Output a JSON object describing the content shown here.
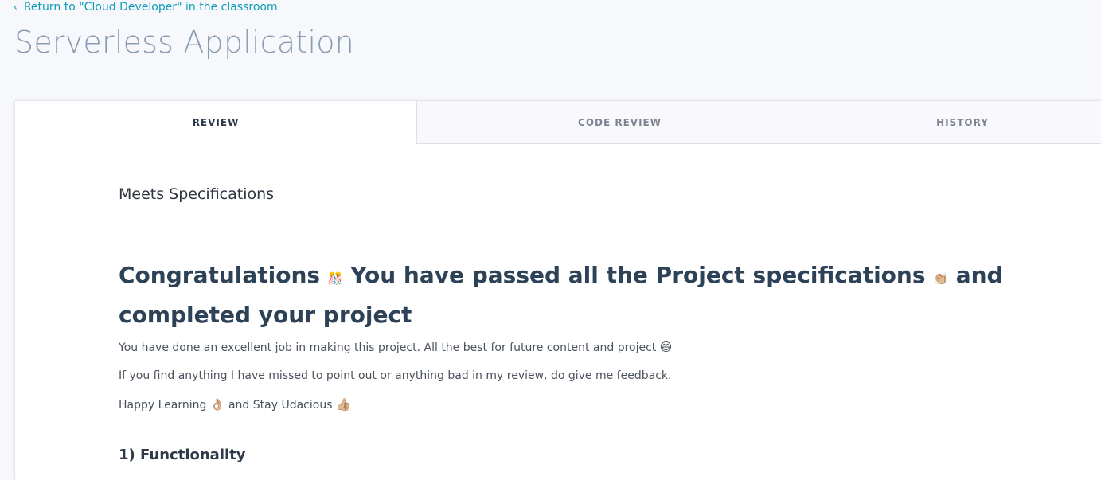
{
  "header": {
    "back_chevron": "‹",
    "back_link": "Return to \"Cloud Developer\" in the classroom",
    "title": "Serverless Application"
  },
  "tabs": [
    {
      "label": "REVIEW",
      "active": true
    },
    {
      "label": "CODE REVIEW",
      "active": false
    },
    {
      "label": "HISTORY",
      "active": false
    }
  ],
  "review": {
    "status": "Meets Specifications",
    "headline": {
      "part1": "Congratulations ",
      "emoji1": "🎊",
      "part2": " You have passed all the Project specifications ",
      "emoji2": "👏🏼",
      "part3": " and completed your project"
    },
    "paragraph1": {
      "text": "You have done an excellent job in making this project. All the best for future content and project ",
      "emoji": "😄"
    },
    "paragraph2": "If you find anything I have missed to point out or anything bad in my review, do give me feedback.",
    "paragraph3": {
      "part1": "Happy Learning ",
      "emoji1": "👌🏼",
      "part2": " and Stay Udacious ",
      "emoji2": "👍🏼"
    },
    "section_heading": "1) Functionality"
  },
  "colors": {
    "link": "#0e9bb8",
    "title": "#8a9cb3",
    "headline": "#2e4257",
    "background": "#f7f8fb"
  }
}
